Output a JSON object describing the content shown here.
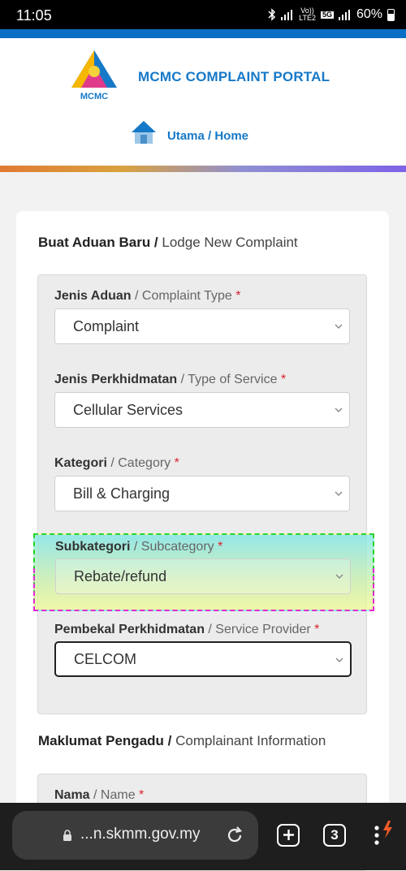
{
  "status": {
    "time": "11:05",
    "net_top": "Vo))",
    "net_bottom": "LTE2",
    "net_5g": "5G",
    "battery": "60%"
  },
  "header": {
    "portal_title": "MCMC COMPLAINT PORTAL",
    "logo_text": "MCMC",
    "home_link": "Utama / Home"
  },
  "lodge": {
    "title_ms": "Buat Aduan Baru / ",
    "title_en": "Lodge New Complaint"
  },
  "fields": [
    {
      "label_ms": "Jenis Aduan",
      "label_en": " / Complaint Type ",
      "required": "*",
      "value": "Complaint"
    },
    {
      "label_ms": "Jenis Perkhidmatan",
      "label_en": " / Type of Service ",
      "required": "*",
      "value": "Cellular Services"
    },
    {
      "label_ms": "Kategori",
      "label_en": " / Category ",
      "required": "*",
      "value": "Bill & Charging"
    },
    {
      "label_ms": "Subkategori",
      "label_en": " / Subcategory ",
      "required": "*",
      "value": "Rebate/refund"
    },
    {
      "label_ms": "Pembekal Perkhidmatan",
      "label_en": " / Service Provider ",
      "required": "*",
      "value": "CELCOM"
    }
  ],
  "complainant": {
    "title_ms": "Maklumat Pengadu / ",
    "title_en": "Complainant Information",
    "name_label_ms": "Nama",
    "name_label_en": " / Name ",
    "name_required": "*"
  },
  "browser": {
    "url": "...n.skmm.gov.my",
    "tab_count": "3",
    "icons": [
      "lock-icon",
      "reload-icon",
      "new-tab-icon",
      "tab-switcher-icon",
      "menu-icon"
    ]
  },
  "colors": {
    "accent": "#1679c8",
    "required": "#d9232e",
    "top_bar": "#0a6fc4"
  }
}
